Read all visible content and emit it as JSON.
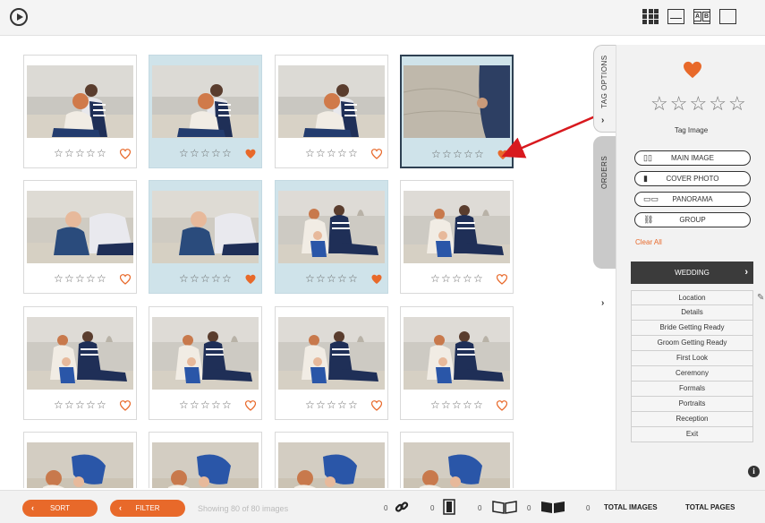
{
  "toolbar": {
    "view_modes": [
      "grid",
      "single",
      "compare",
      "blank"
    ]
  },
  "colors": {
    "accent": "#e8692a",
    "selected_tile": "#cfe3ea",
    "active_border": "#2e4052"
  },
  "images": [
    {
      "id": 1,
      "rating": 0,
      "liked": false,
      "state": "normal",
      "scene": "couple"
    },
    {
      "id": 2,
      "rating": 0,
      "liked": true,
      "state": "selected",
      "scene": "couple"
    },
    {
      "id": 3,
      "rating": 0,
      "liked": false,
      "state": "normal",
      "scene": "couple"
    },
    {
      "id": 4,
      "rating": 0,
      "liked": true,
      "state": "active",
      "scene": "sand"
    },
    {
      "id": 5,
      "rating": 0,
      "liked": false,
      "state": "normal",
      "scene": "baby"
    },
    {
      "id": 6,
      "rating": 0,
      "liked": true,
      "state": "selected",
      "scene": "baby"
    },
    {
      "id": 7,
      "rating": 0,
      "liked": true,
      "state": "selected",
      "scene": "family"
    },
    {
      "id": 8,
      "rating": 0,
      "liked": false,
      "state": "normal",
      "scene": "family"
    },
    {
      "id": 9,
      "rating": 0,
      "liked": false,
      "state": "normal",
      "scene": "family"
    },
    {
      "id": 10,
      "rating": 0,
      "liked": false,
      "state": "normal",
      "scene": "family"
    },
    {
      "id": 11,
      "rating": 0,
      "liked": false,
      "state": "normal",
      "scene": "family"
    },
    {
      "id": 12,
      "rating": 0,
      "liked": false,
      "state": "normal",
      "scene": "family"
    },
    {
      "id": 13,
      "rating": 0,
      "liked": false,
      "state": "normal",
      "scene": "play"
    },
    {
      "id": 14,
      "rating": 0,
      "liked": false,
      "state": "normal",
      "scene": "play"
    },
    {
      "id": 15,
      "rating": 0,
      "liked": false,
      "state": "normal",
      "scene": "play"
    },
    {
      "id": 16,
      "rating": 0,
      "liked": false,
      "state": "normal",
      "scene": "play"
    }
  ],
  "side_tabs": {
    "tag_options": "TAG OPTIONS",
    "orders": "ORDERS"
  },
  "tag_panel": {
    "liked": true,
    "rating": 0,
    "label": "Tag Image",
    "buttons": [
      {
        "label": "MAIN IMAGE",
        "icon": "book-icon"
      },
      {
        "label": "COVER PHOTO",
        "icon": "page-icon"
      },
      {
        "label": "PANORAMA",
        "icon": "panorama-icon"
      },
      {
        "label": "GROUP",
        "icon": "link-icon"
      }
    ],
    "clear_all": "Clear All",
    "category": "WEDDING",
    "subcategories": [
      "Location",
      "Details",
      "Bride Getting Ready",
      "Groom Getting Ready",
      "First Look",
      "Ceremony",
      "Formals",
      "Portraits",
      "Reception",
      "Exit"
    ]
  },
  "bottom": {
    "sort": "SORT",
    "filter": "FILTER",
    "showing": "Showing 80 of 80 images",
    "counts": {
      "group": "0",
      "cover": "0",
      "main": "0",
      "panorama": "0",
      "total_images": "0"
    },
    "total_images_label": "TOTAL IMAGES",
    "total_pages_label": "TOTAL PAGES"
  }
}
